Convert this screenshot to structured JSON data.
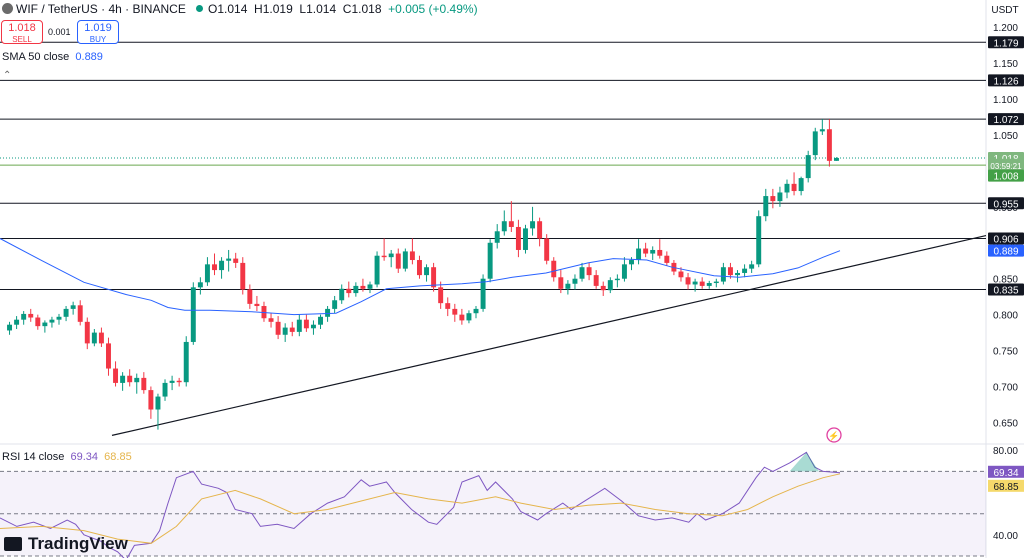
{
  "header": {
    "symbol_title": "WIF / TetherUS · 4h · BINANCE",
    "ohlc_open": "O1.014",
    "ohlc_high": "H1.019",
    "ohlc_low": "L1.014",
    "ohlc_close": "C1.018",
    "ohlc_change": "+0.005 (+0.49%)"
  },
  "trade": {
    "sell_price": "1.018",
    "sell_label": "SELL",
    "spread": "0.001",
    "buy_price": "1.019",
    "buy_label": "BUY"
  },
  "indicators": {
    "sma_label": "SMA 50 close",
    "sma_value": "0.889",
    "rsi_label": "RSI 14 close",
    "rsi_value": "69.34",
    "rsi_ma_value": "68.85"
  },
  "branding": {
    "logo_text": "TradingView"
  },
  "colors": {
    "up": "#089981",
    "down": "#f23645",
    "sma": "#2962ff",
    "rsi": "#7e57c2",
    "rsi_ma": "#e5b54c",
    "price_tag": "#6aa84f"
  },
  "chart_data": {
    "type": "candlestick",
    "currency": "USDT",
    "y_ticks": [
      "1.200",
      "1.150",
      "1.100",
      "1.050",
      "1.000",
      "0.950",
      "0.900",
      "0.850",
      "0.800",
      "0.750",
      "0.700",
      "0.650"
    ],
    "ylim": [
      0.62,
      1.21
    ],
    "horizontal_levels": [
      1.179,
      1.126,
      1.072,
      0.955,
      0.906,
      0.835
    ],
    "price_tags": [
      {
        "label": "1.179",
        "value": 1.179,
        "kind": "level"
      },
      {
        "label": "1.126",
        "value": 1.126,
        "kind": "level"
      },
      {
        "label": "1.072",
        "value": 1.072,
        "kind": "level"
      },
      {
        "label": "1.018",
        "value": 1.018,
        "kind": "last"
      },
      {
        "label": "03:59:21",
        "value": 1.0085,
        "kind": "countdown"
      },
      {
        "label": "1.008",
        "value": 0.9935,
        "kind": "last2"
      },
      {
        "label": "0.955",
        "value": 0.955,
        "kind": "level"
      },
      {
        "label": "0.906",
        "value": 0.906,
        "kind": "level"
      },
      {
        "label": "0.889",
        "value": 0.889,
        "kind": "sma"
      },
      {
        "label": "0.835",
        "value": 0.835,
        "kind": "level"
      }
    ],
    "trendline": {
      "from": [
        0.632,
        0
      ],
      "to": [
        0.91,
        1
      ]
    },
    "ohlc": [
      [
        0.778,
        0.79,
        0.772,
        0.786
      ],
      [
        0.786,
        0.798,
        0.78,
        0.793
      ],
      [
        0.793,
        0.805,
        0.786,
        0.801
      ],
      [
        0.801,
        0.808,
        0.79,
        0.796
      ],
      [
        0.796,
        0.8,
        0.779,
        0.784
      ],
      [
        0.784,
        0.792,
        0.775,
        0.789
      ],
      [
        0.789,
        0.797,
        0.782,
        0.793
      ],
      [
        0.793,
        0.801,
        0.786,
        0.797
      ],
      [
        0.797,
        0.812,
        0.791,
        0.808
      ],
      [
        0.808,
        0.818,
        0.8,
        0.813
      ],
      [
        0.813,
        0.82,
        0.785,
        0.79
      ],
      [
        0.79,
        0.796,
        0.752,
        0.76
      ],
      [
        0.76,
        0.78,
        0.756,
        0.775
      ],
      [
        0.775,
        0.782,
        0.755,
        0.76
      ],
      [
        0.76,
        0.768,
        0.715,
        0.725
      ],
      [
        0.725,
        0.735,
        0.7,
        0.705
      ],
      [
        0.705,
        0.72,
        0.694,
        0.715
      ],
      [
        0.715,
        0.724,
        0.7,
        0.706
      ],
      [
        0.706,
        0.718,
        0.69,
        0.712
      ],
      [
        0.712,
        0.72,
        0.69,
        0.695
      ],
      [
        0.695,
        0.7,
        0.655,
        0.668
      ],
      [
        0.668,
        0.69,
        0.64,
        0.686
      ],
      [
        0.686,
        0.71,
        0.68,
        0.705
      ],
      [
        0.705,
        0.715,
        0.695,
        0.708
      ],
      [
        0.708,
        0.712,
        0.7,
        0.706
      ],
      [
        0.706,
        0.77,
        0.7,
        0.762
      ],
      [
        0.762,
        0.845,
        0.758,
        0.838
      ],
      [
        0.838,
        0.852,
        0.828,
        0.845
      ],
      [
        0.845,
        0.88,
        0.84,
        0.87
      ],
      [
        0.87,
        0.885,
        0.855,
        0.862
      ],
      [
        0.862,
        0.88,
        0.85,
        0.875
      ],
      [
        0.875,
        0.89,
        0.86,
        0.878
      ],
      [
        0.878,
        0.886,
        0.865,
        0.872
      ],
      [
        0.872,
        0.88,
        0.828,
        0.835
      ],
      [
        0.835,
        0.842,
        0.808,
        0.815
      ],
      [
        0.815,
        0.826,
        0.805,
        0.812
      ],
      [
        0.812,
        0.818,
        0.79,
        0.795
      ],
      [
        0.795,
        0.802,
        0.782,
        0.79
      ],
      [
        0.79,
        0.798,
        0.766,
        0.772
      ],
      [
        0.772,
        0.788,
        0.762,
        0.782
      ],
      [
        0.782,
        0.79,
        0.77,
        0.776
      ],
      [
        0.776,
        0.8,
        0.77,
        0.793
      ],
      [
        0.793,
        0.8,
        0.776,
        0.781
      ],
      [
        0.781,
        0.792,
        0.772,
        0.786
      ],
      [
        0.786,
        0.8,
        0.78,
        0.797
      ],
      [
        0.797,
        0.812,
        0.79,
        0.808
      ],
      [
        0.808,
        0.826,
        0.802,
        0.82
      ],
      [
        0.82,
        0.842,
        0.815,
        0.836
      ],
      [
        0.836,
        0.846,
        0.824,
        0.83
      ],
      [
        0.83,
        0.845,
        0.825,
        0.84
      ],
      [
        0.84,
        0.85,
        0.832,
        0.836
      ],
      [
        0.836,
        0.846,
        0.83,
        0.842
      ],
      [
        0.842,
        0.888,
        0.838,
        0.882
      ],
      [
        0.882,
        0.906,
        0.875,
        0.88
      ],
      [
        0.88,
        0.89,
        0.866,
        0.885
      ],
      [
        0.885,
        0.892,
        0.858,
        0.864
      ],
      [
        0.864,
        0.892,
        0.86,
        0.888
      ],
      [
        0.888,
        0.906,
        0.87,
        0.876
      ],
      [
        0.876,
        0.882,
        0.85,
        0.855
      ],
      [
        0.855,
        0.87,
        0.846,
        0.866
      ],
      [
        0.866,
        0.872,
        0.832,
        0.838
      ],
      [
        0.838,
        0.846,
        0.808,
        0.816
      ],
      [
        0.816,
        0.824,
        0.798,
        0.808
      ],
      [
        0.808,
        0.815,
        0.79,
        0.8
      ],
      [
        0.8,
        0.808,
        0.786,
        0.792
      ],
      [
        0.792,
        0.806,
        0.788,
        0.802
      ],
      [
        0.802,
        0.812,
        0.795,
        0.808
      ],
      [
        0.808,
        0.856,
        0.804,
        0.85
      ],
      [
        0.85,
        0.905,
        0.845,
        0.9
      ],
      [
        0.9,
        0.926,
        0.892,
        0.916
      ],
      [
        0.916,
        0.945,
        0.91,
        0.93
      ],
      [
        0.93,
        0.958,
        0.915,
        0.922
      ],
      [
        0.922,
        0.932,
        0.88,
        0.89
      ],
      [
        0.89,
        0.925,
        0.885,
        0.92
      ],
      [
        0.92,
        0.95,
        0.91,
        0.93
      ],
      [
        0.93,
        0.935,
        0.895,
        0.906
      ],
      [
        0.906,
        0.912,
        0.87,
        0.875
      ],
      [
        0.875,
        0.88,
        0.846,
        0.852
      ],
      [
        0.852,
        0.862,
        0.83,
        0.836
      ],
      [
        0.836,
        0.848,
        0.828,
        0.843
      ],
      [
        0.843,
        0.856,
        0.835,
        0.85
      ],
      [
        0.85,
        0.872,
        0.846,
        0.866
      ],
      [
        0.866,
        0.872,
        0.848,
        0.855
      ],
      [
        0.855,
        0.862,
        0.836,
        0.84
      ],
      [
        0.84,
        0.846,
        0.826,
        0.834
      ],
      [
        0.834,
        0.852,
        0.83,
        0.848
      ],
      [
        0.848,
        0.856,
        0.838,
        0.85
      ],
      [
        0.85,
        0.88,
        0.846,
        0.87
      ],
      [
        0.87,
        0.88,
        0.862,
        0.876
      ],
      [
        0.876,
        0.905,
        0.87,
        0.892
      ],
      [
        0.892,
        0.9,
        0.88,
        0.885
      ],
      [
        0.885,
        0.895,
        0.876,
        0.89
      ],
      [
        0.89,
        0.905,
        0.878,
        0.882
      ],
      [
        0.882,
        0.888,
        0.868,
        0.872
      ],
      [
        0.872,
        0.876,
        0.855,
        0.86
      ],
      [
        0.86,
        0.866,
        0.846,
        0.852
      ],
      [
        0.852,
        0.858,
        0.835,
        0.842
      ],
      [
        0.842,
        0.85,
        0.832,
        0.846
      ],
      [
        0.846,
        0.852,
        0.836,
        0.84
      ],
      [
        0.84,
        0.847,
        0.836,
        0.844
      ],
      [
        0.844,
        0.85,
        0.838,
        0.846
      ],
      [
        0.846,
        0.872,
        0.842,
        0.866
      ],
      [
        0.866,
        0.872,
        0.85,
        0.855
      ],
      [
        0.855,
        0.862,
        0.845,
        0.858
      ],
      [
        0.858,
        0.87,
        0.852,
        0.864
      ],
      [
        0.864,
        0.875,
        0.858,
        0.87
      ],
      [
        0.87,
        0.945,
        0.866,
        0.937
      ],
      [
        0.937,
        0.975,
        0.93,
        0.965
      ],
      [
        0.965,
        0.975,
        0.948,
        0.958
      ],
      [
        0.958,
        0.978,
        0.95,
        0.97
      ],
      [
        0.97,
        0.988,
        0.962,
        0.982
      ],
      [
        0.982,
        0.998,
        0.966,
        0.972
      ],
      [
        0.972,
        0.992,
        0.966,
        0.99
      ],
      [
        0.99,
        1.028,
        0.984,
        1.022
      ],
      [
        1.022,
        1.06,
        1.015,
        1.055
      ],
      [
        1.055,
        1.072,
        1.05,
        1.058
      ],
      [
        1.058,
        1.072,
        1.006,
        1.014
      ],
      [
        1.014,
        1.019,
        1.014,
        1.018
      ]
    ],
    "sma50": [
      [
        0,
        0.906
      ],
      [
        0.05,
        0.875
      ],
      [
        0.1,
        0.845
      ],
      [
        0.15,
        0.828
      ],
      [
        0.18,
        0.82
      ],
      [
        0.2,
        0.81
      ],
      [
        0.22,
        0.806
      ],
      [
        0.25,
        0.806
      ],
      [
        0.3,
        0.804
      ],
      [
        0.35,
        0.8
      ],
      [
        0.4,
        0.802
      ],
      [
        0.43,
        0.818
      ],
      [
        0.46,
        0.836
      ],
      [
        0.5,
        0.84
      ],
      [
        0.55,
        0.843
      ],
      [
        0.58,
        0.846
      ],
      [
        0.61,
        0.852
      ],
      [
        0.65,
        0.858
      ],
      [
        0.7,
        0.872
      ],
      [
        0.73,
        0.878
      ],
      [
        0.77,
        0.876
      ],
      [
        0.8,
        0.866
      ],
      [
        0.85,
        0.854
      ],
      [
        0.88,
        0.852
      ],
      [
        0.92,
        0.857
      ],
      [
        0.95,
        0.865
      ],
      [
        0.98,
        0.88
      ],
      [
        1.0,
        0.889
      ]
    ],
    "rsi": {
      "value": 69.34,
      "ma": 68.85,
      "ylim": [
        30,
        82
      ],
      "ticks": [
        "80.00",
        "40.00"
      ],
      "bands": [
        70,
        50,
        30
      ],
      "rsi_series": [
        [
          0,
          48
        ],
        [
          0.02,
          44
        ],
        [
          0.04,
          46
        ],
        [
          0.06,
          43
        ],
        [
          0.08,
          47
        ],
        [
          0.09,
          45
        ],
        [
          0.1,
          40
        ],
        [
          0.12,
          37
        ],
        [
          0.13,
          34
        ],
        [
          0.14,
          32
        ],
        [
          0.15,
          28
        ],
        [
          0.16,
          35
        ],
        [
          0.18,
          36
        ],
        [
          0.19,
          42
        ],
        [
          0.2,
          55
        ],
        [
          0.21,
          67
        ],
        [
          0.23,
          70
        ],
        [
          0.24,
          64
        ],
        [
          0.26,
          62
        ],
        [
          0.27,
          60
        ],
        [
          0.28,
          52
        ],
        [
          0.3,
          50
        ],
        [
          0.31,
          44
        ],
        [
          0.33,
          45
        ],
        [
          0.35,
          43
        ],
        [
          0.37,
          50
        ],
        [
          0.39,
          55
        ],
        [
          0.41,
          58
        ],
        [
          0.43,
          66
        ],
        [
          0.44,
          63
        ],
        [
          0.46,
          65
        ],
        [
          0.47,
          60
        ],
        [
          0.49,
          52
        ],
        [
          0.51,
          46
        ],
        [
          0.52,
          45
        ],
        [
          0.54,
          53
        ],
        [
          0.55,
          65
        ],
        [
          0.57,
          68
        ],
        [
          0.58,
          61
        ],
        [
          0.59,
          65
        ],
        [
          0.61,
          57
        ],
        [
          0.62,
          51
        ],
        [
          0.64,
          47
        ],
        [
          0.65,
          50
        ],
        [
          0.67,
          55
        ],
        [
          0.68,
          52
        ],
        [
          0.7,
          57
        ],
        [
          0.72,
          62
        ],
        [
          0.74,
          56
        ],
        [
          0.76,
          49
        ],
        [
          0.78,
          47
        ],
        [
          0.8,
          48
        ],
        [
          0.82,
          46
        ],
        [
          0.83,
          50
        ],
        [
          0.84,
          47
        ],
        [
          0.86,
          50
        ],
        [
          0.88,
          55
        ],
        [
          0.9,
          67
        ],
        [
          0.91,
          72
        ],
        [
          0.92,
          70
        ],
        [
          0.94,
          74
        ],
        [
          0.96,
          79
        ],
        [
          0.97,
          72
        ],
        [
          0.98,
          70
        ],
        [
          1.0,
          69.34
        ]
      ],
      "ma_series": [
        [
          0,
          43
        ],
        [
          0.05,
          44
        ],
        [
          0.1,
          42
        ],
        [
          0.14,
          38
        ],
        [
          0.18,
          36
        ],
        [
          0.21,
          44
        ],
        [
          0.24,
          57
        ],
        [
          0.28,
          61
        ],
        [
          0.31,
          57
        ],
        [
          0.35,
          50
        ],
        [
          0.39,
          52
        ],
        [
          0.43,
          56
        ],
        [
          0.47,
          60
        ],
        [
          0.51,
          57
        ],
        [
          0.55,
          55
        ],
        [
          0.59,
          58
        ],
        [
          0.62,
          55
        ],
        [
          0.66,
          52
        ],
        [
          0.7,
          54
        ],
        [
          0.74,
          55
        ],
        [
          0.78,
          52
        ],
        [
          0.82,
          50
        ],
        [
          0.86,
          49
        ],
        [
          0.89,
          52
        ],
        [
          0.92,
          58
        ],
        [
          0.95,
          63
        ],
        [
          0.98,
          67
        ],
        [
          1.0,
          68.85
        ]
      ]
    }
  }
}
